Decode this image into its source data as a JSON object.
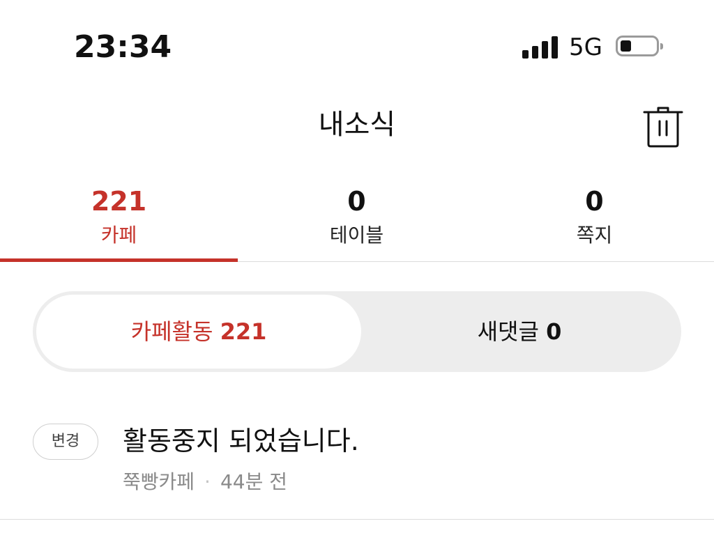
{
  "status_bar": {
    "time": "23:34",
    "network": "5G",
    "battery_level": 0.3
  },
  "header": {
    "title": "내소식",
    "trash_icon": "trash-icon"
  },
  "tabs": [
    {
      "count": "221",
      "label": "카페",
      "active": true
    },
    {
      "count": "0",
      "label": "테이블",
      "active": false
    },
    {
      "count": "0",
      "label": "쪽지",
      "active": false
    }
  ],
  "segment": {
    "active": {
      "label": "카페활동",
      "count": "221"
    },
    "inactive": {
      "label": "새댓글",
      "count": "0"
    }
  },
  "notifications": [
    {
      "badge": "변경",
      "title": "활동중지 되었습니다.",
      "source": "쭉빵카페",
      "time": "44분 전"
    }
  ],
  "colors": {
    "accent": "#c5322a",
    "divider": "#dcdcdc",
    "segment_bg": "#ededed"
  }
}
